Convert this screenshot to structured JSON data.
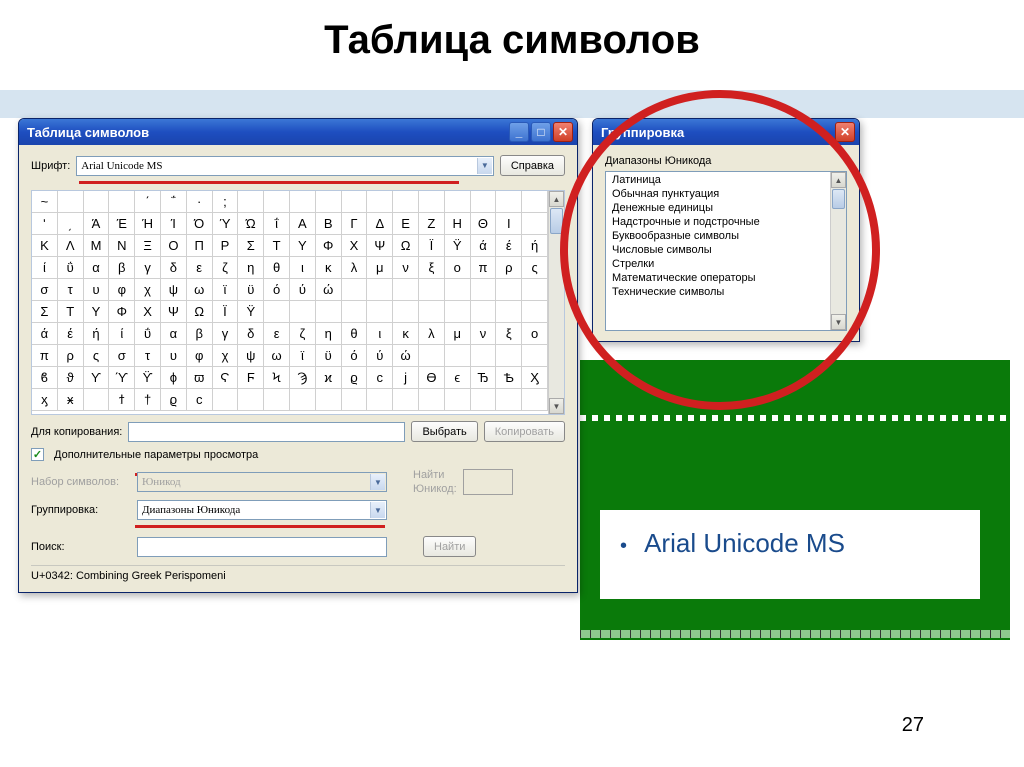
{
  "slide": {
    "title": "Таблица символов",
    "page_number": "27",
    "bullet": "Arial Unicode MS"
  },
  "main_window": {
    "title": "Таблица символов",
    "font_label": "Шрифт:",
    "font_value": "Arial Unicode MS",
    "help_btn": "Справка",
    "copy_label": "Для копирования:",
    "copy_value": "",
    "select_btn": "Выбрать",
    "copy_btn": "Копировать",
    "adv_checkbox": "Дополнительные параметры просмотра",
    "charset_label": "Набор символов:",
    "charset_value": "Юникод",
    "group_label": "Группировка:",
    "group_value": "Диапазоны Юникода",
    "search_label": "Поиск:",
    "search_value": "",
    "search_btn": "Найти",
    "find_unicode_label_1": "Найти",
    "find_unicode_label_2": "Юникод:",
    "status": "U+0342: Combining Greek Perispomeni"
  },
  "char_rows": [
    [
      "~",
      "",
      "",
      "",
      "΄",
      "΅",
      "·",
      ";",
      "",
      "",
      "",
      "",
      "",
      "",
      "",
      "",
      "",
      "",
      "",
      ""
    ],
    [
      "ʹ",
      "͵",
      "Ά",
      "Έ",
      "Ή",
      "Ί",
      "Ό",
      "Ύ",
      "Ώ",
      "ΐ",
      "Α",
      "Β",
      "Γ",
      "Δ",
      "Ε",
      "Ζ",
      "Η",
      "Θ",
      "Ι",
      ""
    ],
    [
      "Κ",
      "Λ",
      "Μ",
      "Ν",
      "Ξ",
      "Ο",
      "Π",
      "Ρ",
      "Σ",
      "Τ",
      "Υ",
      "Φ",
      "Χ",
      "Ψ",
      "Ω",
      "Ϊ",
      "Ϋ",
      "ά",
      "έ",
      "ή"
    ],
    [
      "ί",
      "ΰ",
      "α",
      "β",
      "γ",
      "δ",
      "ε",
      "ζ",
      "η",
      "θ",
      "ι",
      "κ",
      "λ",
      "μ",
      "ν",
      "ξ",
      "ο",
      "π",
      "ρ",
      "ς"
    ],
    [
      "σ",
      "τ",
      "υ",
      "φ",
      "χ",
      "ψ",
      "ω",
      "ϊ",
      "ϋ",
      "ό",
      "ύ",
      "ώ",
      "",
      "",
      "",
      "",
      "",
      "",
      "",
      ""
    ],
    [
      "Σ",
      "Τ",
      "Υ",
      "Φ",
      "Χ",
      "Ψ",
      "Ω",
      "Ϊ",
      "Ϋ",
      "",
      "",
      "",
      "",
      "",
      "",
      "",
      "",
      "",
      "",
      ""
    ],
    [
      "ά",
      "έ",
      "ή",
      "ί",
      "ΰ",
      "α",
      "β",
      "γ",
      "δ",
      "ε",
      "ζ",
      "η",
      "θ",
      "ι",
      "κ",
      "λ",
      "μ",
      "ν",
      "ξ",
      "ο"
    ],
    [
      "π",
      "ρ",
      "ς",
      "σ",
      "τ",
      "υ",
      "φ",
      "χ",
      "ψ",
      "ω",
      "ϊ",
      "ϋ",
      "ό",
      "ύ",
      "ώ",
      "",
      "",
      "",
      "",
      ""
    ],
    [
      "ϐ",
      "ϑ",
      "ϒ",
      "ϓ",
      "ϔ",
      "ϕ",
      "ϖ",
      "Ϛ",
      "Ϝ",
      "Ϟ",
      "Ϡ",
      "ϰ",
      "ϱ",
      "ϲ",
      "ϳ",
      "ϴ",
      "ϵ",
      "Ђ",
      "Ѣ",
      "Ӽ"
    ],
    [
      "ӽ",
      "ӿ",
      "",
      "ϯ",
      "†",
      "ϱ",
      "ϲ",
      "",
      "",
      "",
      "",
      "",
      "",
      "",
      "",
      "",
      "",
      "",
      "",
      ""
    ]
  ],
  "group_window": {
    "title": "Группировка",
    "heading": "Диапазоны Юникода",
    "items": [
      "Латиница",
      "Обычная пунктуация",
      "Денежные единицы",
      "Надстрочные и подстрочные",
      "Буквообразные символы",
      "Числовые символы",
      "Стрелки",
      "Математические операторы",
      "Технические символы"
    ]
  }
}
